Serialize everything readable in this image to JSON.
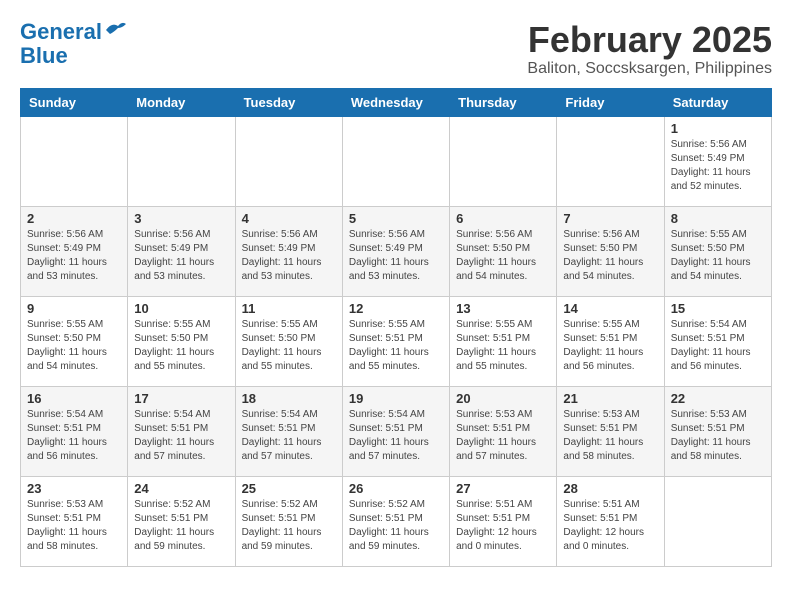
{
  "header": {
    "logo_line1": "General",
    "logo_line2": "Blue",
    "month_year": "February 2025",
    "location": "Baliton, Soccsksargen, Philippines"
  },
  "weekdays": [
    "Sunday",
    "Monday",
    "Tuesday",
    "Wednesday",
    "Thursday",
    "Friday",
    "Saturday"
  ],
  "weeks": [
    [
      {
        "day": "",
        "info": ""
      },
      {
        "day": "",
        "info": ""
      },
      {
        "day": "",
        "info": ""
      },
      {
        "day": "",
        "info": ""
      },
      {
        "day": "",
        "info": ""
      },
      {
        "day": "",
        "info": ""
      },
      {
        "day": "1",
        "info": "Sunrise: 5:56 AM\nSunset: 5:49 PM\nDaylight: 11 hours\nand 52 minutes."
      }
    ],
    [
      {
        "day": "2",
        "info": "Sunrise: 5:56 AM\nSunset: 5:49 PM\nDaylight: 11 hours\nand 53 minutes."
      },
      {
        "day": "3",
        "info": "Sunrise: 5:56 AM\nSunset: 5:49 PM\nDaylight: 11 hours\nand 53 minutes."
      },
      {
        "day": "4",
        "info": "Sunrise: 5:56 AM\nSunset: 5:49 PM\nDaylight: 11 hours\nand 53 minutes."
      },
      {
        "day": "5",
        "info": "Sunrise: 5:56 AM\nSunset: 5:49 PM\nDaylight: 11 hours\nand 53 minutes."
      },
      {
        "day": "6",
        "info": "Sunrise: 5:56 AM\nSunset: 5:50 PM\nDaylight: 11 hours\nand 54 minutes."
      },
      {
        "day": "7",
        "info": "Sunrise: 5:56 AM\nSunset: 5:50 PM\nDaylight: 11 hours\nand 54 minutes."
      },
      {
        "day": "8",
        "info": "Sunrise: 5:55 AM\nSunset: 5:50 PM\nDaylight: 11 hours\nand 54 minutes."
      }
    ],
    [
      {
        "day": "9",
        "info": "Sunrise: 5:55 AM\nSunset: 5:50 PM\nDaylight: 11 hours\nand 54 minutes."
      },
      {
        "day": "10",
        "info": "Sunrise: 5:55 AM\nSunset: 5:50 PM\nDaylight: 11 hours\nand 55 minutes."
      },
      {
        "day": "11",
        "info": "Sunrise: 5:55 AM\nSunset: 5:50 PM\nDaylight: 11 hours\nand 55 minutes."
      },
      {
        "day": "12",
        "info": "Sunrise: 5:55 AM\nSunset: 5:51 PM\nDaylight: 11 hours\nand 55 minutes."
      },
      {
        "day": "13",
        "info": "Sunrise: 5:55 AM\nSunset: 5:51 PM\nDaylight: 11 hours\nand 55 minutes."
      },
      {
        "day": "14",
        "info": "Sunrise: 5:55 AM\nSunset: 5:51 PM\nDaylight: 11 hours\nand 56 minutes."
      },
      {
        "day": "15",
        "info": "Sunrise: 5:54 AM\nSunset: 5:51 PM\nDaylight: 11 hours\nand 56 minutes."
      }
    ],
    [
      {
        "day": "16",
        "info": "Sunrise: 5:54 AM\nSunset: 5:51 PM\nDaylight: 11 hours\nand 56 minutes."
      },
      {
        "day": "17",
        "info": "Sunrise: 5:54 AM\nSunset: 5:51 PM\nDaylight: 11 hours\nand 57 minutes."
      },
      {
        "day": "18",
        "info": "Sunrise: 5:54 AM\nSunset: 5:51 PM\nDaylight: 11 hours\nand 57 minutes."
      },
      {
        "day": "19",
        "info": "Sunrise: 5:54 AM\nSunset: 5:51 PM\nDaylight: 11 hours\nand 57 minutes."
      },
      {
        "day": "20",
        "info": "Sunrise: 5:53 AM\nSunset: 5:51 PM\nDaylight: 11 hours\nand 57 minutes."
      },
      {
        "day": "21",
        "info": "Sunrise: 5:53 AM\nSunset: 5:51 PM\nDaylight: 11 hours\nand 58 minutes."
      },
      {
        "day": "22",
        "info": "Sunrise: 5:53 AM\nSunset: 5:51 PM\nDaylight: 11 hours\nand 58 minutes."
      }
    ],
    [
      {
        "day": "23",
        "info": "Sunrise: 5:53 AM\nSunset: 5:51 PM\nDaylight: 11 hours\nand 58 minutes."
      },
      {
        "day": "24",
        "info": "Sunrise: 5:52 AM\nSunset: 5:51 PM\nDaylight: 11 hours\nand 59 minutes."
      },
      {
        "day": "25",
        "info": "Sunrise: 5:52 AM\nSunset: 5:51 PM\nDaylight: 11 hours\nand 59 minutes."
      },
      {
        "day": "26",
        "info": "Sunrise: 5:52 AM\nSunset: 5:51 PM\nDaylight: 11 hours\nand 59 minutes."
      },
      {
        "day": "27",
        "info": "Sunrise: 5:51 AM\nSunset: 5:51 PM\nDaylight: 12 hours\nand 0 minutes."
      },
      {
        "day": "28",
        "info": "Sunrise: 5:51 AM\nSunset: 5:51 PM\nDaylight: 12 hours\nand 0 minutes."
      },
      {
        "day": "",
        "info": ""
      }
    ]
  ]
}
